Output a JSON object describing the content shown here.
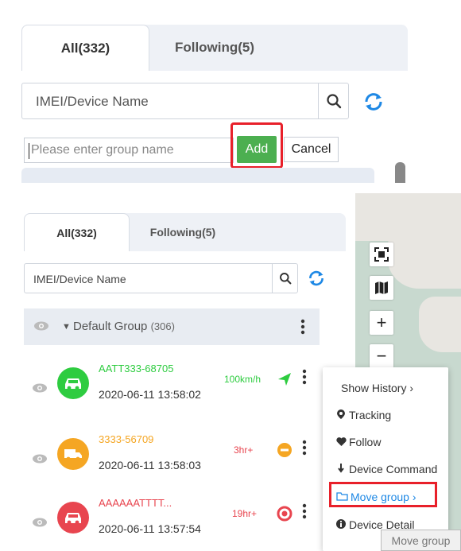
{
  "top": {
    "tabs": [
      {
        "label": "All(332)"
      },
      {
        "label": "Following(5)"
      }
    ],
    "search_placeholder": "IMEI/Device Name",
    "group_input_placeholder": "Please enter group name",
    "add_label": "Add",
    "cancel_label": "Cancel"
  },
  "bottom": {
    "tabs": [
      {
        "label": "All(332)"
      },
      {
        "label": "Following(5)"
      }
    ],
    "search_placeholder": "IMEI/Device Name",
    "group": {
      "name": "Default Group",
      "count": "(306)"
    },
    "devices": [
      {
        "name": "AATT333-68705",
        "time": "2020-06-11 13:58:02",
        "status": "100km/h",
        "color": "#2ecc40"
      },
      {
        "name": "3333-56709",
        "time": "2020-06-11 13:58:03",
        "status": "3hr+",
        "color": "#f5a623"
      },
      {
        "name": "AAAAAATTTT...",
        "time": "2020-06-11 13:57:54",
        "status": "19hr+",
        "color": "#e8454f"
      }
    ]
  },
  "menu": {
    "items": [
      {
        "label": "Show History",
        "suffix": "›"
      },
      {
        "label": "Tracking"
      },
      {
        "label": "Follow"
      },
      {
        "label": "Device Command"
      },
      {
        "label": "Move group",
        "suffix": "›"
      },
      {
        "label": "Device Detail"
      }
    ],
    "tooltip": "Move group"
  },
  "map_controls": {
    "zoom_in": "+",
    "zoom_out": "−"
  },
  "colors": {
    "accent_blue": "#1e88e5",
    "highlight_red": "#e8202a",
    "add_green": "#4caf50"
  }
}
